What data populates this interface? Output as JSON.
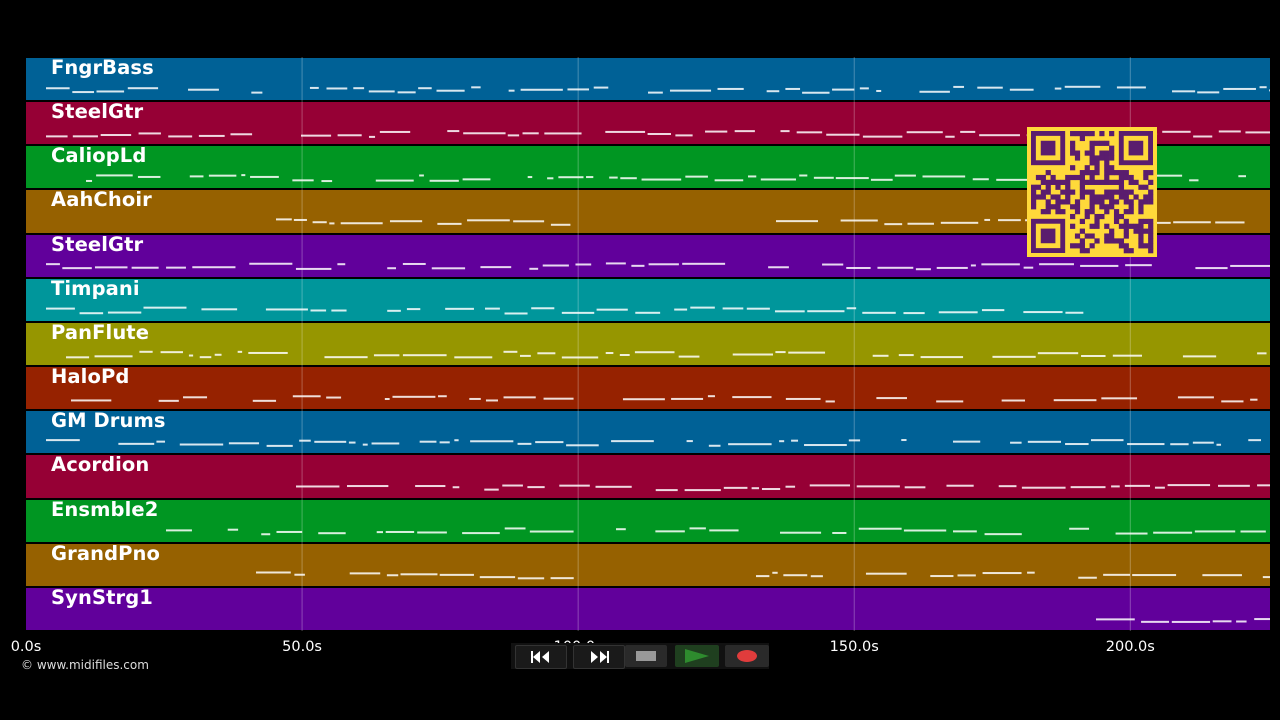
{
  "tracks": [
    {
      "name": "FngrBass",
      "color": "#006196"
    },
    {
      "name": "SteelGtr",
      "color": "#960035"
    },
    {
      "name": "CaliopLd",
      "color": "#009622"
    },
    {
      "name": "AahChoir",
      "color": "#966100"
    },
    {
      "name": "SteelGtr",
      "color": "#61009b"
    },
    {
      "name": "Timpani",
      "color": "#00969b"
    },
    {
      "name": "PanFlute",
      "color": "#969600"
    },
    {
      "name": "HaloPd",
      "color": "#962200"
    },
    {
      "name": "GM Drums",
      "color": "#006196"
    },
    {
      "name": "Acordion",
      "color": "#960035"
    },
    {
      "name": "Ensmble2",
      "color": "#009622"
    },
    {
      "name": "GrandPno",
      "color": "#966100"
    },
    {
      "name": "SynStrg1",
      "color": "#61009b"
    }
  ],
  "timeline": {
    "ticks": [
      "0.0s",
      "50.0s",
      "100.0s",
      "150.0s",
      "200.0s"
    ],
    "tick_seconds": [
      0,
      50,
      100,
      150,
      200
    ],
    "total_seconds": 225.3
  },
  "copyright": "© www.midifiles.com",
  "transport": {
    "buttons": [
      "rewind",
      "fast-forward",
      "stop",
      "play",
      "record"
    ],
    "play_color": "#2e8b2e",
    "record_color": "#e03c3c"
  },
  "qr_colors": {
    "fg": "#5a1d6e",
    "bg": "#ffd93a"
  }
}
